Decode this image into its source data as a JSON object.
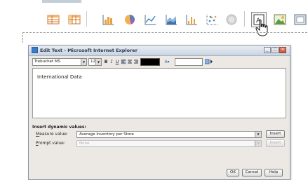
{
  "toolbar": {
    "buttons": [
      {
        "icon": "table-icon"
      },
      {
        "icon": "crosstab-icon"
      },
      {
        "icon": "bar-chart-icon"
      },
      {
        "icon": "pie-chart-icon"
      },
      {
        "icon": "line-chart-icon"
      },
      {
        "icon": "area-chart-icon"
      },
      {
        "icon": "histogram-icon"
      },
      {
        "icon": "scatter-chart-icon"
      },
      {
        "icon": "gauge-icon"
      },
      {
        "icon": "text-box-icon"
      },
      {
        "icon": "image-icon"
      },
      {
        "icon": "frame-icon"
      }
    ]
  },
  "dialog": {
    "title": "Edit Text - Microsoft Internet Explorer",
    "font_name": "Trebuchet MS",
    "font_size": "12",
    "bold": "B",
    "italic": "I",
    "underline": "U",
    "text_color": "#000000",
    "editor_text": "International Data",
    "dynamic_heading": "Insert dynamic values:",
    "measure_label_key": "M",
    "measure_label_rest": "easure value:",
    "measure_value": "Average Inventory per Store",
    "prompt_label_key": "P",
    "prompt_label_rest": "rompt value:",
    "prompt_value": "None",
    "insert_label": "Insert",
    "ok_label": "OK",
    "cancel_label": "Cancel",
    "help_label": "Help"
  }
}
